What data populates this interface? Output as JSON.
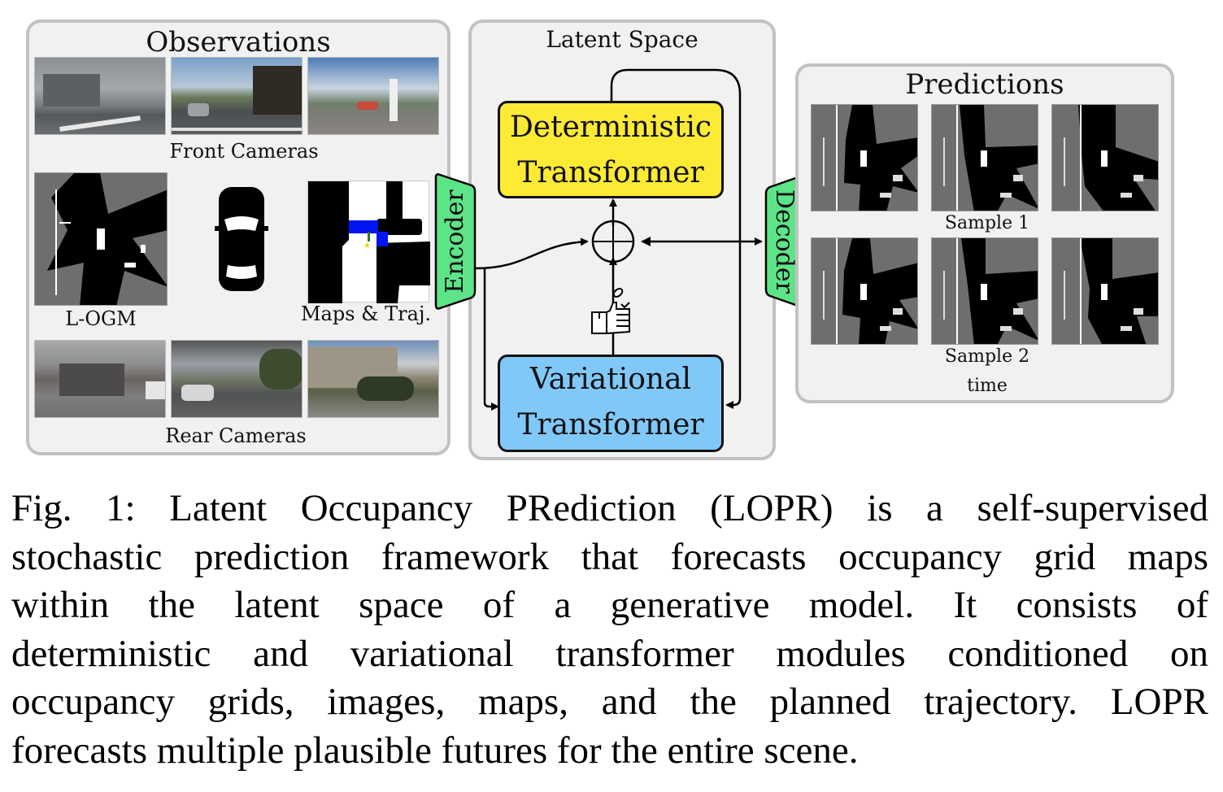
{
  "figure": {
    "observations": {
      "title": "Observations",
      "front_cameras_label": "Front Cameras",
      "rear_cameras_label": "Rear Cameras",
      "logm_label": "L-OGM",
      "maps_label": "Maps & Traj."
    },
    "encoder_label": "Encoder",
    "decoder_label": "Decoder",
    "latent_space": {
      "title": "Latent Space",
      "deterministic_line1": "Deterministic",
      "deterministic_line2": "Transformer",
      "variational_line1": "Variational",
      "variational_line2": "Transformer"
    },
    "predictions": {
      "title": "Predictions",
      "sample1_label": "Sample 1",
      "sample2_label": "Sample 2",
      "time_label": "time"
    },
    "colors": {
      "deterministic": "#fdea35",
      "variational": "#80c8f8",
      "encoder_decoder": "#5ee488",
      "panel_bg": "#f1f1f1",
      "panel_border": "#c2c2c2",
      "trajectory_blue": "#0015f0"
    }
  },
  "caption": {
    "lines": [
      "Fig. 1: Latent Occupancy PRediction (LOPR) is a self-supervised",
      "stochastic prediction framework that forecasts occupancy grid maps",
      "within the latent space of a generative model. It consists of",
      "deterministic and variational transformer modules conditioned on",
      "occupancy grids, images, maps, and the planned trajectory. LOPR",
      "forecasts multiple plausible futures for the entire scene."
    ]
  }
}
